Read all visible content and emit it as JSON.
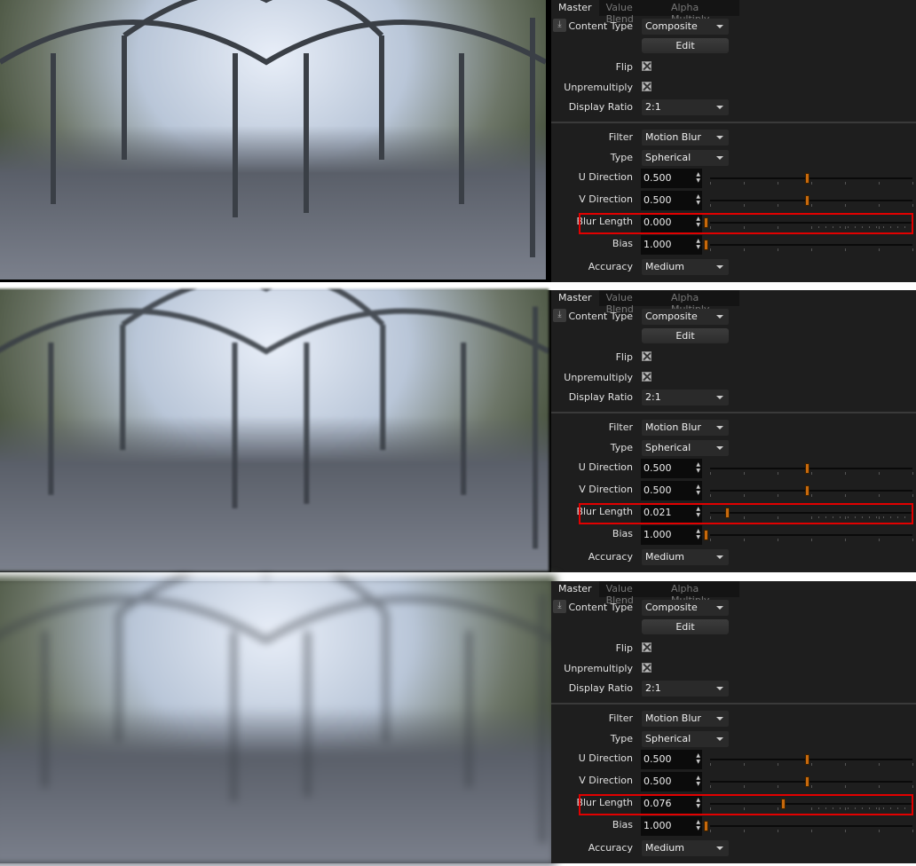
{
  "tabs": [
    "Master",
    "Value Blend",
    "Alpha Multiply"
  ],
  "labels": {
    "content_type": "Content Type",
    "edit": "Edit",
    "flip": "Flip",
    "unpremultiply": "Unpremultiply",
    "display_ratio": "Display Ratio",
    "filter": "Filter",
    "type": "Type",
    "u_direction": "U Direction",
    "v_direction": "V Direction",
    "blur_length": "Blur Length",
    "bias": "Bias",
    "accuracy": "Accuracy"
  },
  "icons": {
    "import": "download-icon",
    "spin": "spinner-arrows-icon",
    "dropdown": "caret-down-icon",
    "checkbox": "checked-box-icon"
  },
  "colors": {
    "highlight": "#e20000",
    "slider_handle": "#c8690c",
    "panel_bg": "#1e1e1e"
  },
  "panels": [
    {
      "content_type": "Composite",
      "flip": true,
      "unpremultiply": true,
      "display_ratio": "2:1",
      "filter": "Motion Blur",
      "type": "Spherical",
      "u_direction": "0.500",
      "v_direction": "0.500",
      "blur_length": "0.000",
      "bias": "1.000",
      "accuracy": "Medium",
      "blur_amount": 0.0
    },
    {
      "content_type": "Composite",
      "flip": true,
      "unpremultiply": true,
      "display_ratio": "2:1",
      "filter": "Motion Blur",
      "type": "Spherical",
      "u_direction": "0.500",
      "v_direction": "0.500",
      "blur_length": "0.021",
      "bias": "1.000",
      "accuracy": "Medium",
      "blur_amount": 0.021
    },
    {
      "content_type": "Composite",
      "flip": true,
      "unpremultiply": true,
      "display_ratio": "2:1",
      "filter": "Motion Blur",
      "type": "Spherical",
      "u_direction": "0.500",
      "v_direction": "0.500",
      "blur_length": "0.076",
      "bias": "1.000",
      "accuracy": "Medium",
      "blur_amount": 0.076
    }
  ]
}
